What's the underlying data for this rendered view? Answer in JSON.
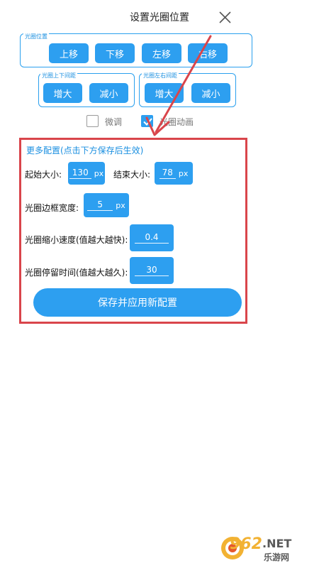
{
  "header": {
    "title": "设置光圈位置"
  },
  "position_group": {
    "label": "光圈位置",
    "buttons": {
      "up": "上移",
      "down": "下移",
      "left": "左移",
      "right": "右移"
    }
  },
  "vertical_spacing_group": {
    "label": "光圈上下间距",
    "increase": "增大",
    "decrease": "减小"
  },
  "horizontal_spacing_group": {
    "label": "光圈左右间距",
    "increase": "增大",
    "decrease": "减小"
  },
  "options": {
    "fine_tune": {
      "label": "微调",
      "checked": false
    },
    "aperture_animation": {
      "label": "光圈动画",
      "checked": true
    }
  },
  "more_config": {
    "title": "更多配置(点击下方保存后生效)",
    "start_size": {
      "label": "起始大小:",
      "value": "130",
      "unit": "px"
    },
    "end_size": {
      "label": "结束大小:",
      "value": "78",
      "unit": "px"
    },
    "border_width": {
      "label": "光圈边框宽度:",
      "value": "5",
      "unit": "px"
    },
    "shrink_speed": {
      "label": "光圈缩小速度(值越大越快):",
      "value": "0.4"
    },
    "stay_time": {
      "label": "光圈停留时间(值越大越久):",
      "value": "30"
    },
    "save_button": "保存并应用新配置"
  },
  "watermark": {
    "number": "962",
    "suffix": ".NET",
    "site": "乐游网"
  },
  "colors": {
    "accent": "#2d9ff0",
    "highlight": "#d9454b"
  }
}
